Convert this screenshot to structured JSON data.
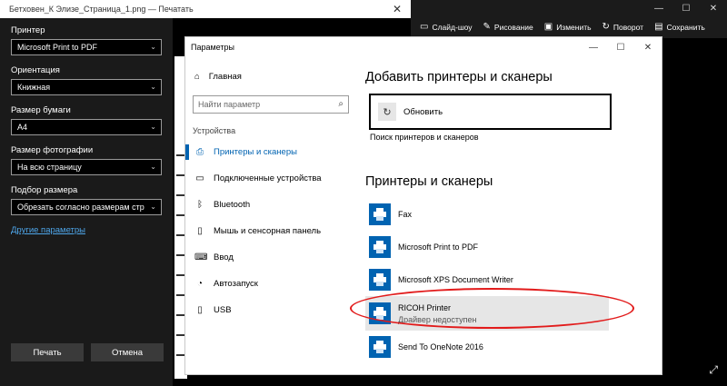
{
  "print_dialog": {
    "title": "Бетховен_К Элизе_Страница_1.png — Печатать",
    "printer_label": "Принтер",
    "printer_value": "Microsoft Print to PDF",
    "orientation_label": "Ориентация",
    "orientation_value": "Книжная",
    "paper_label": "Размер бумаги",
    "paper_value": "A4",
    "photo_size_label": "Размер фотографии",
    "photo_size_value": "На всю страницу",
    "fit_label": "Подбор размера",
    "fit_value": "Обрезать согласно размерам стр",
    "more_link": "Другие параметры",
    "print_button": "Печать",
    "cancel_button": "Отмена"
  },
  "photos_toolbar": {
    "slideshow": "Слайд-шоу",
    "draw": "Рисование",
    "edit": "Изменить",
    "rotate": "Поворот",
    "save": "Сохранить"
  },
  "settings": {
    "window_title": "Параметры",
    "nav": {
      "home": "Главная",
      "search_placeholder": "Найти параметр",
      "section": "Устройства",
      "items": [
        {
          "label": "Принтеры и сканеры",
          "icon": "printer-icon"
        },
        {
          "label": "Подключенные устройства",
          "icon": "devices-icon"
        },
        {
          "label": "Bluetooth",
          "icon": "bluetooth-icon"
        },
        {
          "label": "Мышь и сенсорная панель",
          "icon": "mouse-icon"
        },
        {
          "label": "Ввод",
          "icon": "keyboard-icon"
        },
        {
          "label": "Автозапуск",
          "icon": "autoplay-icon"
        },
        {
          "label": "USB",
          "icon": "usb-icon"
        }
      ]
    },
    "content": {
      "add_heading": "Добавить принтеры и сканеры",
      "refresh_label": "Обновить",
      "refresh_note": "Поиск принтеров и сканеров",
      "list_heading": "Принтеры и сканеры",
      "printers": [
        {
          "name": "Fax",
          "status": ""
        },
        {
          "name": "Microsoft Print to PDF",
          "status": ""
        },
        {
          "name": "Microsoft XPS Document Writer",
          "status": ""
        },
        {
          "name": "RICOH Printer",
          "status": "Драйвер недоступен"
        },
        {
          "name": "Send To OneNote 2016",
          "status": ""
        }
      ]
    }
  },
  "colors": {
    "accent": "#0063b1",
    "highlight": "#e21b1b",
    "link": "#4ea6ea"
  }
}
